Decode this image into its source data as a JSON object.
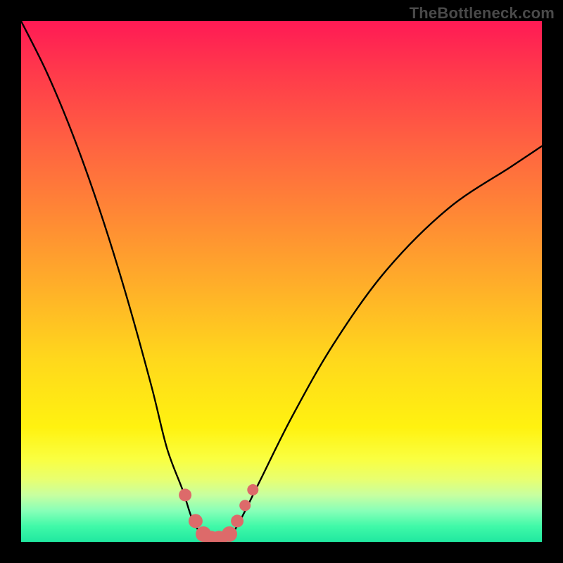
{
  "watermark": "TheBottleneck.com",
  "chart_data": {
    "type": "line",
    "title": "",
    "xlabel": "",
    "ylabel": "",
    "xlim": [
      0,
      100
    ],
    "ylim": [
      0,
      100
    ],
    "series": [
      {
        "name": "bottleneck-curve",
        "x": [
          0,
          5,
          10,
          15,
          20,
          25,
          28,
          31,
          33,
          35,
          36,
          38,
          40,
          42,
          46,
          52,
          60,
          70,
          82,
          94,
          100
        ],
        "values": [
          100,
          90,
          78,
          64,
          48,
          30,
          18,
          10,
          4,
          1,
          0,
          0,
          1,
          4,
          12,
          24,
          38,
          52,
          64,
          72,
          76
        ]
      }
    ],
    "markers": {
      "name": "highlight-dots",
      "color": "#dd6a6a",
      "x": [
        31.5,
        33.5,
        35,
        36.5,
        38,
        40,
        41.5,
        43,
        44.5
      ],
      "values": [
        9,
        4,
        1.5,
        0.5,
        0.5,
        1.5,
        4,
        7,
        10
      ],
      "radius": [
        9,
        10,
        11,
        12,
        12,
        11,
        9,
        8,
        8
      ]
    }
  }
}
